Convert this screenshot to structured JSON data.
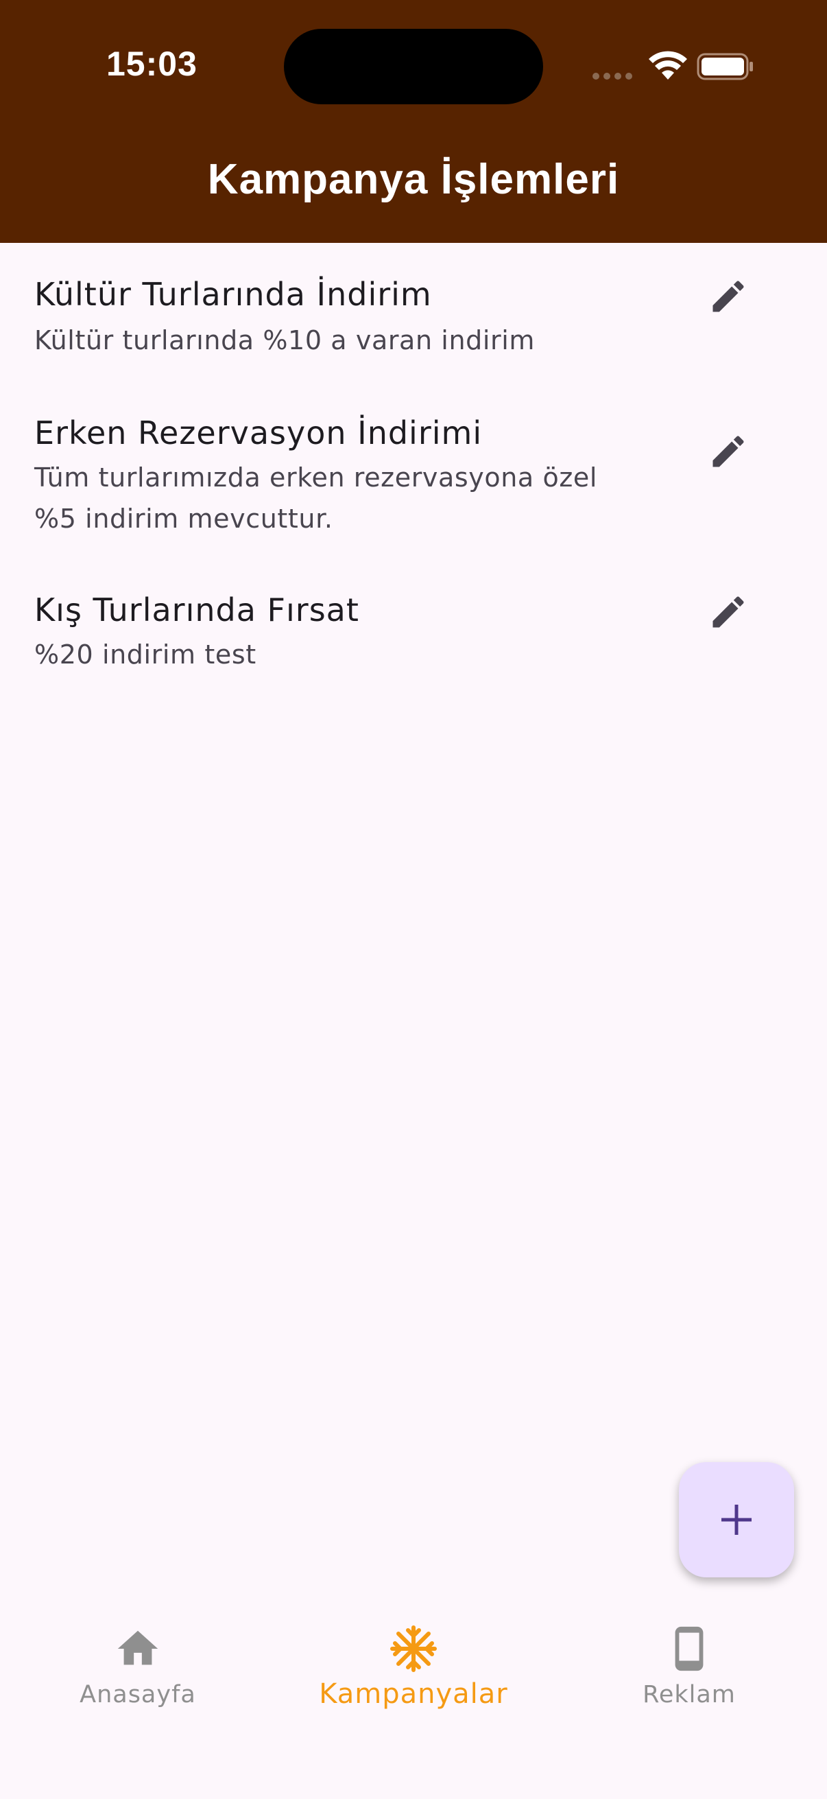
{
  "status_bar": {
    "time": "15:03"
  },
  "header": {
    "title": "Kampanya İşlemleri"
  },
  "campaigns": [
    {
      "title": "Kültür Turlarında İndirim",
      "subtitle_lines": [
        "Kültür turlarında %10 a varan indirim"
      ]
    },
    {
      "title": "Erken Rezervasyon İndirimi",
      "subtitle_lines": [
        "Tüm turlarımızda erken rezervasyona özel",
        "%5 indirim mevcuttur."
      ]
    },
    {
      "title": "Kış Turlarında Fırsat",
      "subtitle_lines": [
        "%20 indirim test"
      ]
    }
  ],
  "icons": {
    "edit": "pencil-icon",
    "fab": "plus-icon",
    "home": "home-icon",
    "campaigns": "snowflake-icon",
    "ads": "phone-icon"
  },
  "fab": {
    "icon": "+"
  },
  "bottom_nav": {
    "items": [
      {
        "label": "Anasayfa",
        "active": false
      },
      {
        "label": "Kampanyalar",
        "active": true
      },
      {
        "label": "Reklam",
        "active": false
      }
    ]
  },
  "colors": {
    "header_bg": "#572300",
    "page_bg": "#fdf7fc",
    "active_nav": "#f59a13",
    "inactive_nav": "#8f8f8f",
    "fab_bg": "#eaddff",
    "fab_icon": "#4f378b"
  }
}
